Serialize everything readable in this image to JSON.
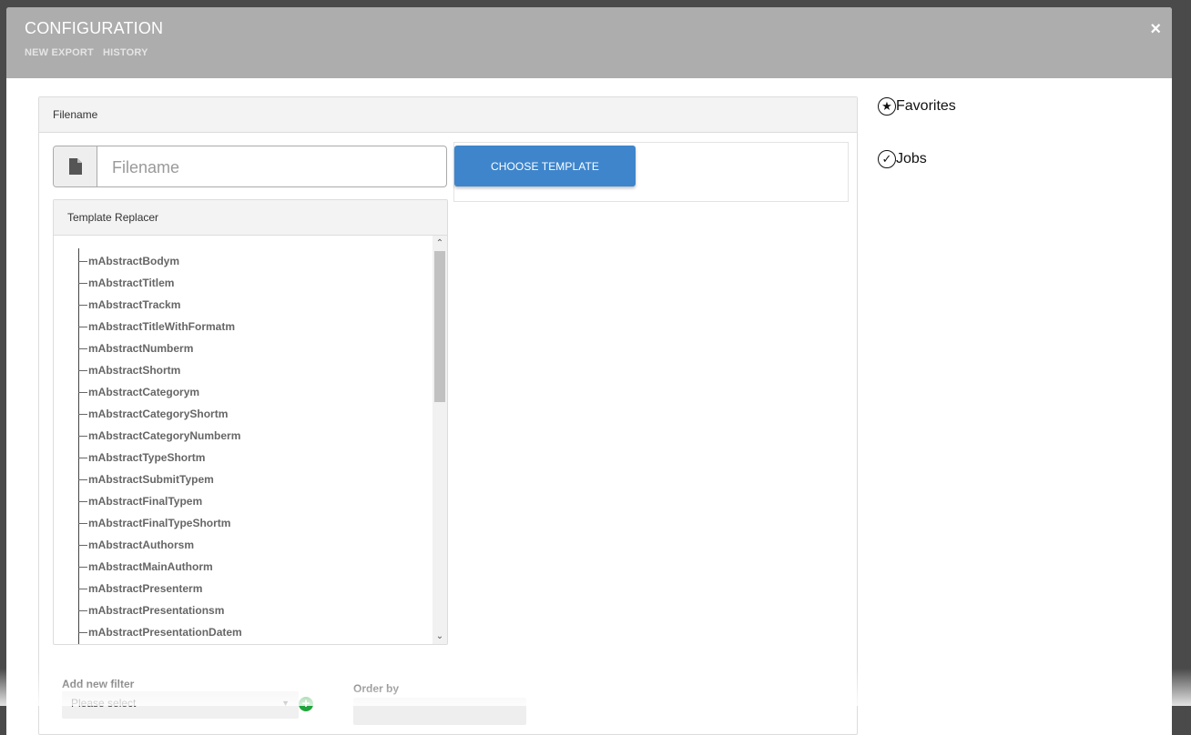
{
  "modal": {
    "title": "CONFIGURATION",
    "tabs": [
      {
        "label": "NEW EXPORT"
      },
      {
        "label": "HISTORY"
      }
    ],
    "close_glyph": "×"
  },
  "filename_panel": {
    "heading": "Filename",
    "input_placeholder": "Filename",
    "input_value": "",
    "file_icon": "file-icon",
    "choose_template_label": "CHOOSE TEMPLATE"
  },
  "template_replacer": {
    "heading": "Template Replacer",
    "items": [
      "mAbstractBodym",
      "mAbstractTitlem",
      "mAbstractTrackm",
      "mAbstractTitleWithFormatm",
      "mAbstractNumberm",
      "mAbstractShortm",
      "mAbstractCategorym",
      "mAbstractCategoryShortm",
      "mAbstractCategoryNumberm",
      "mAbstractTypeShortm",
      "mAbstractSubmitTypem",
      "mAbstractFinalTypem",
      "mAbstractFinalTypeShortm",
      "mAbstractAuthorsm",
      "mAbstractMainAuthorm",
      "mAbstractPresenterm",
      "mAbstractPresentationsm",
      "mAbstractPresentationDatem"
    ]
  },
  "filters": {
    "add_filter_label": "Add new filter",
    "select_value": "Please select",
    "order_by_label": "Order by"
  },
  "sidebar": {
    "favorites_label": "Favorites",
    "jobs_label": "Jobs"
  },
  "colors": {
    "header_bg": "#adadad",
    "primary_button": "#3e85cc",
    "add_button": "#1fa53a"
  }
}
